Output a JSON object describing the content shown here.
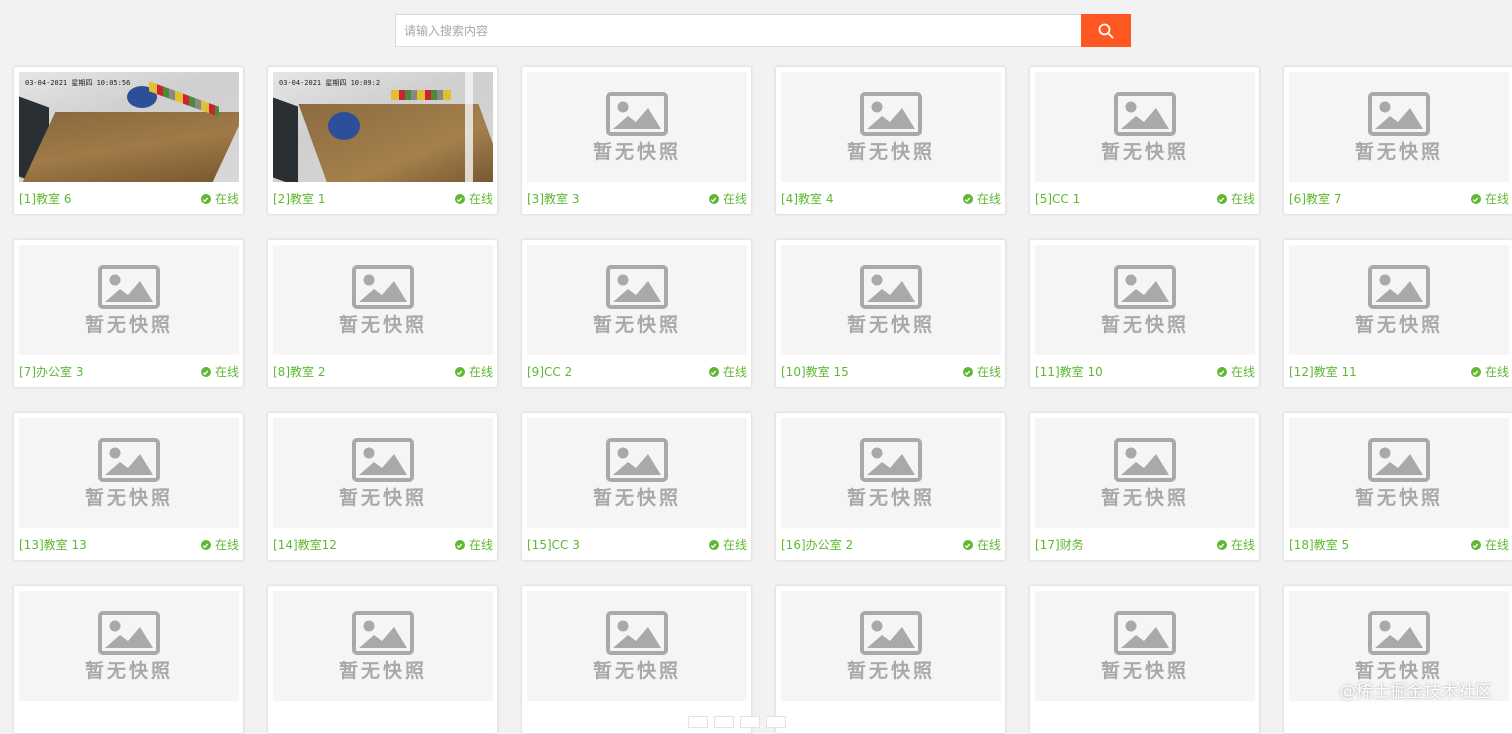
{
  "search": {
    "placeholder": "请输入搜索内容",
    "button_icon": "search-icon"
  },
  "placeholder": {
    "text": "暂无快照",
    "icon": "image-placeholder-icon"
  },
  "cameras": [
    {
      "label": "[1]教室 6",
      "status": "在线",
      "has_snapshot": true,
      "timestamp": "03-04-2021 星期四 10:05:56"
    },
    {
      "label": "[2]教室 1",
      "status": "在线",
      "has_snapshot": true,
      "timestamp": "03-04-2021 星期四 10:09:2"
    },
    {
      "label": "[3]教室 3",
      "status": "在线",
      "has_snapshot": false
    },
    {
      "label": "[4]教室 4",
      "status": "在线",
      "has_snapshot": false
    },
    {
      "label": "[5]CC 1",
      "status": "在线",
      "has_snapshot": false
    },
    {
      "label": "[6]教室 7",
      "status": "在线",
      "has_snapshot": false
    },
    {
      "label": "[7]办公室 3",
      "status": "在线",
      "has_snapshot": false
    },
    {
      "label": "[8]教室 2",
      "status": "在线",
      "has_snapshot": false
    },
    {
      "label": "[9]CC 2",
      "status": "在线",
      "has_snapshot": false
    },
    {
      "label": "[10]教室 15",
      "status": "在线",
      "has_snapshot": false
    },
    {
      "label": "[11]教室 10",
      "status": "在线",
      "has_snapshot": false
    },
    {
      "label": "[12]教室 11",
      "status": "在线",
      "has_snapshot": false
    },
    {
      "label": "[13]教室 13",
      "status": "在线",
      "has_snapshot": false
    },
    {
      "label": "[14]教室12",
      "status": "在线",
      "has_snapshot": false
    },
    {
      "label": "[15]CC 3",
      "status": "在线",
      "has_snapshot": false
    },
    {
      "label": "[16]办公室 2",
      "status": "在线",
      "has_snapshot": false
    },
    {
      "label": "[17]财务",
      "status": "在线",
      "has_snapshot": false
    },
    {
      "label": "[18]教室 5",
      "status": "在线",
      "has_snapshot": false
    },
    {
      "label": "",
      "status": "",
      "has_snapshot": false
    },
    {
      "label": "",
      "status": "",
      "has_snapshot": false
    },
    {
      "label": "",
      "status": "",
      "has_snapshot": false
    },
    {
      "label": "",
      "status": "",
      "has_snapshot": false
    },
    {
      "label": "",
      "status": "",
      "has_snapshot": false
    },
    {
      "label": "",
      "status": "",
      "has_snapshot": false
    }
  ],
  "watermark": "@稀土掘金技术社区",
  "colors": {
    "accent": "#ff5722",
    "online": "#5fb832",
    "placeholder_gray": "#a9a9a9"
  }
}
